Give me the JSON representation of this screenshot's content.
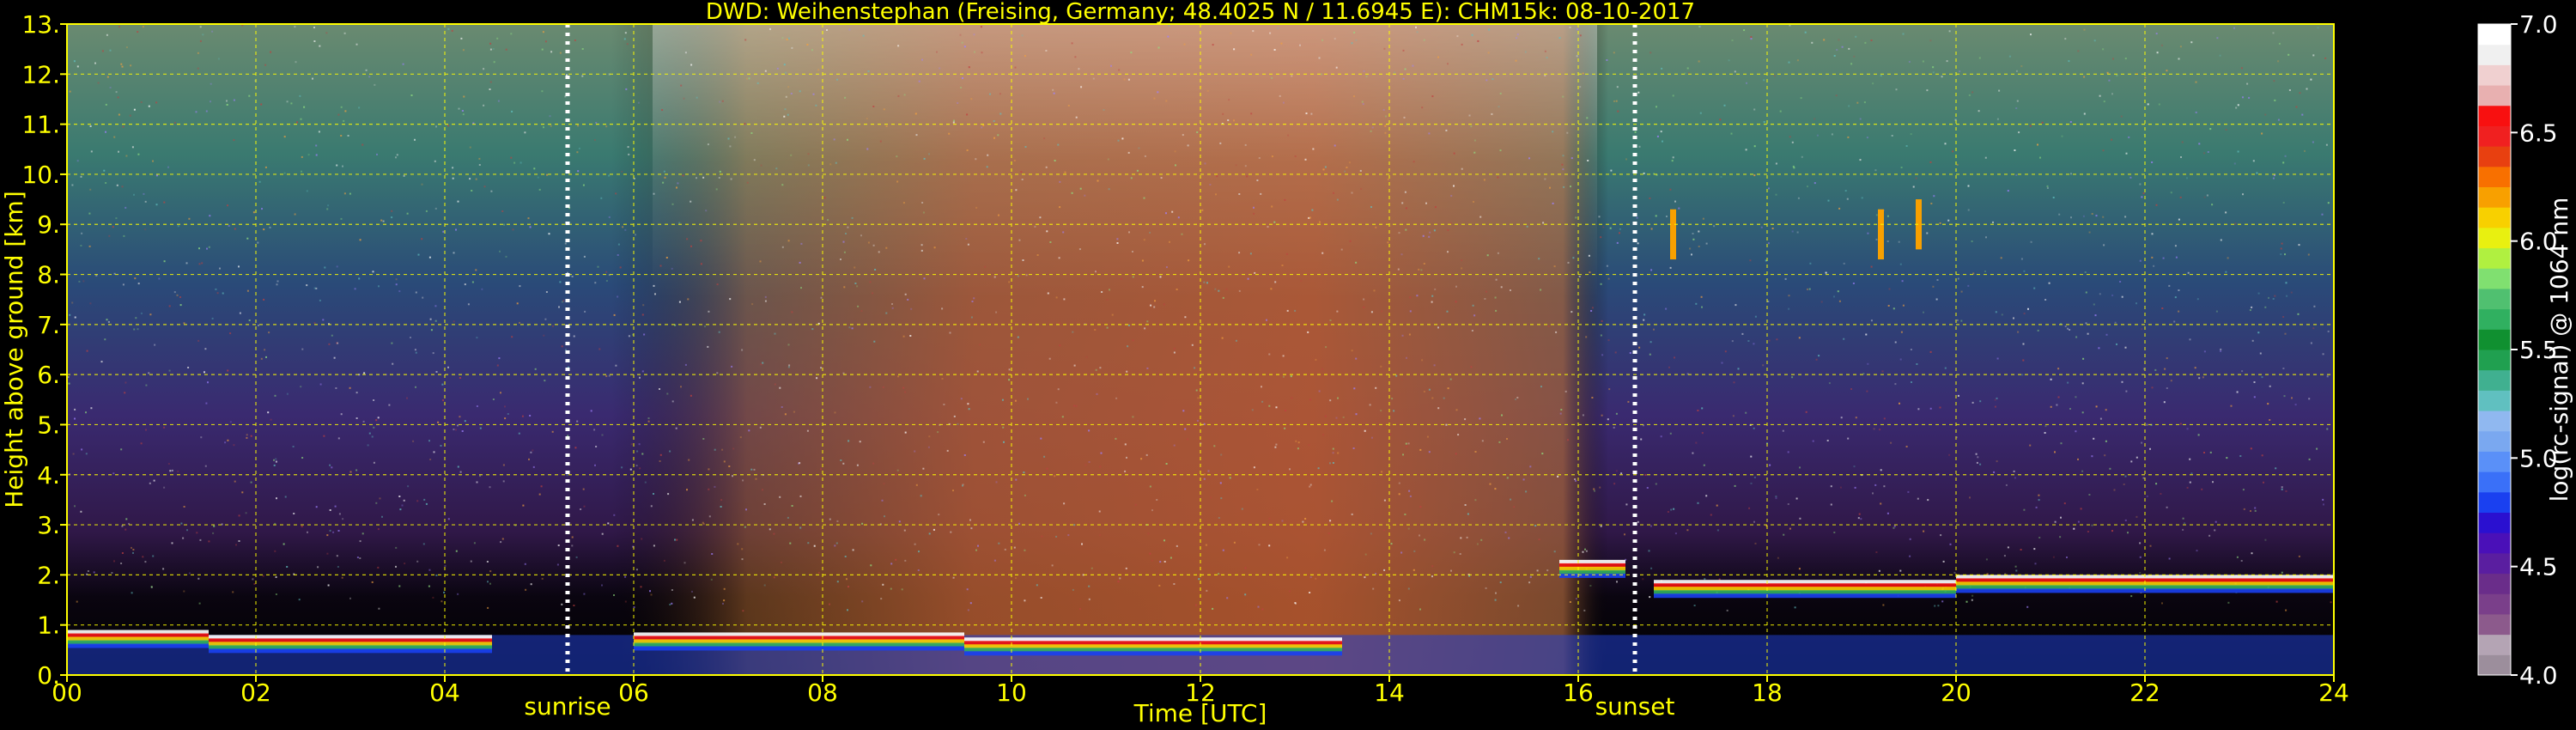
{
  "chart_data": {
    "type": "heatmap",
    "title": "DWD: Weihenstephan (Freising, Germany; 48.4025 N / 11.6945 E):    CHM15k: 08-10-2017",
    "xlabel": "Time [UTC]",
    "ylabel": "Height above ground [km]",
    "xlim": [
      0,
      24
    ],
    "ylim": [
      0,
      13
    ],
    "x_ticks": [
      0,
      2,
      4,
      6,
      8,
      10,
      12,
      14,
      16,
      18,
      20,
      22,
      24
    ],
    "x_tick_labels": [
      "00",
      "02",
      "04",
      "06",
      "08",
      "10",
      "12",
      "14",
      "16",
      "18",
      "20",
      "22",
      "24"
    ],
    "y_ticks": [
      0,
      1,
      2,
      3,
      4,
      5,
      6,
      7,
      8,
      9,
      10,
      11,
      12,
      13
    ],
    "y_tick_labels": [
      "0.",
      "1.",
      "2.",
      "3.",
      "4.",
      "5.",
      "6.",
      "7.",
      "8.",
      "9.",
      "10.",
      "11.",
      "12.",
      "13."
    ],
    "grid": true,
    "markers": [
      {
        "label": "sunrise",
        "x": 5.3
      },
      {
        "label": "sunset",
        "x": 16.6
      }
    ],
    "colorbar": {
      "label": "log(rc-signal) @ 1064 nm",
      "range": [
        4.0,
        7.0
      ],
      "tick_labels": [
        "4.0",
        "4.5",
        "5.0",
        "5.5",
        "6.0",
        "6.5",
        "7.0"
      ],
      "colors": [
        "#9c8e9c",
        "#b4a4b4",
        "#8c5a8c",
        "#7a3f8a",
        "#6a2d8a",
        "#5a1ea0",
        "#4a10b8",
        "#2a10d0",
        "#1a40f0",
        "#3a70f8",
        "#5a90f8",
        "#7aa8f0",
        "#90b8f0",
        "#60c0c0",
        "#40b090",
        "#20a050",
        "#109030",
        "#30b060",
        "#50c070",
        "#80e070",
        "#b0f040",
        "#e8f010",
        "#f8d000",
        "#f8a000",
        "#f87000",
        "#e84010",
        "#f02020",
        "#f81010",
        "#e8b0b0",
        "#f0d0d0",
        "#f0f0f0",
        "#ffffff"
      ]
    },
    "cloud_base_layers": [
      {
        "x0": 0,
        "x1": 1.5,
        "y": 0.9
      },
      {
        "x0": 1.5,
        "x1": 4.5,
        "y": 0.8
      },
      {
        "x0": 6.0,
        "x1": 9.5,
        "y": 0.85
      },
      {
        "x0": 9.5,
        "x1": 13.5,
        "y": 0.75
      },
      {
        "x0": 15.8,
        "x1": 16.5,
        "y": 2.3
      },
      {
        "x0": 16.8,
        "x1": 20.0,
        "y": 1.9
      },
      {
        "x0": 20.0,
        "x1": 24.0,
        "y": 2.0
      }
    ],
    "cirrus_features": [
      {
        "x": 17.0,
        "y": 8.8
      },
      {
        "x": 19.2,
        "y": 8.8
      },
      {
        "x": 19.6,
        "y": 9.0
      }
    ]
  }
}
